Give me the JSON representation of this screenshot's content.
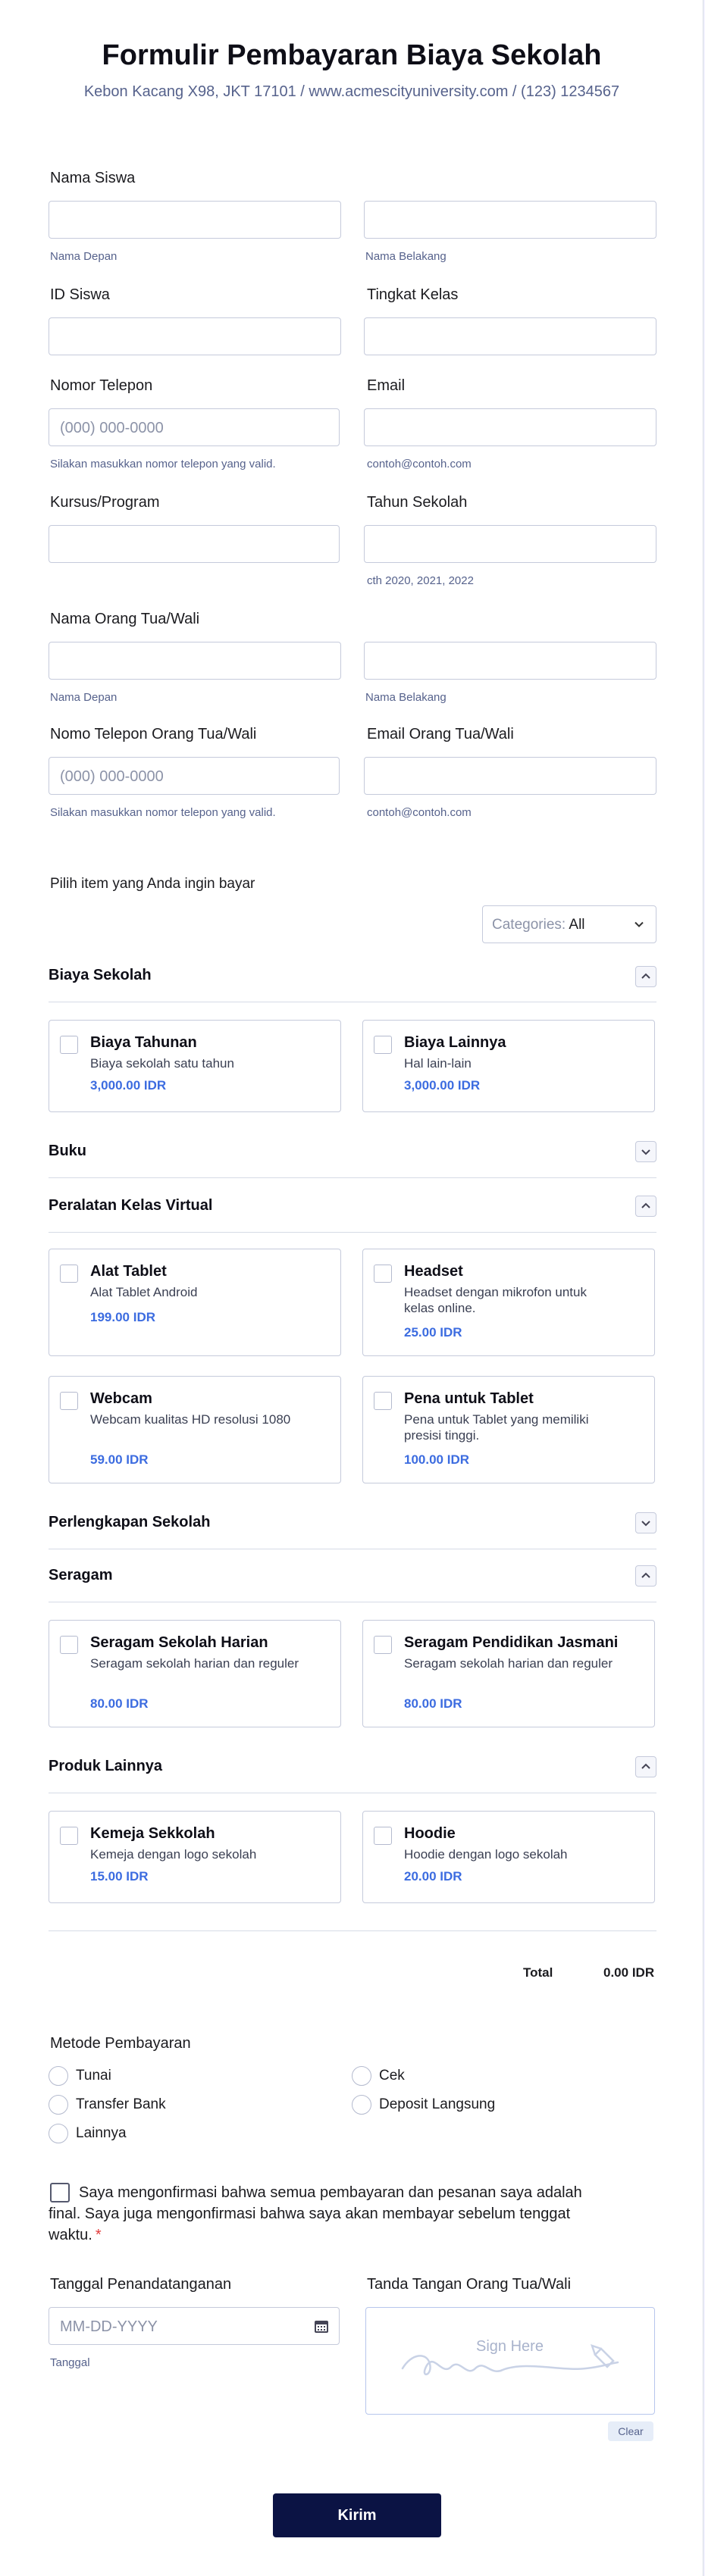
{
  "header": {
    "title": "Formulir Pembayaran Biaya Sekolah",
    "subtitle": "Kebon Kacang X98, JKT 17101 / www.acmescityuniversity.com / (123) 1234567"
  },
  "fields": {
    "student_name": {
      "label": "Nama Siswa",
      "first_sub": "Nama Depan",
      "last_sub": "Nama Belakang"
    },
    "student_id": {
      "label": "ID Siswa"
    },
    "grade": {
      "label": "Tingkat Kelas"
    },
    "phone": {
      "label": "Nomor Telepon",
      "placeholder": "(000) 000-0000",
      "sub": "Silakan masukkan nomor telepon yang valid."
    },
    "email": {
      "label": "Email",
      "sub": "contoh@contoh.com"
    },
    "course": {
      "label": "Kursus/Program"
    },
    "school_year": {
      "label": "Tahun Sekolah",
      "sub": "cth 2020, 2021, 2022"
    },
    "parent_name": {
      "label": "Nama Orang Tua/Wali",
      "first_sub": "Nama Depan",
      "last_sub": "Nama Belakang"
    },
    "parent_phone": {
      "label": "Nomo Telepon Orang Tua/Wali",
      "placeholder": "(000) 000-0000",
      "sub": "Silakan masukkan nomor telepon yang valid."
    },
    "parent_email": {
      "label": "Email Orang Tua/Wali",
      "sub": "contoh@contoh.com"
    }
  },
  "products_heading": "Pilih item yang Anda ingin bayar",
  "category_filter": {
    "label": "Categories:",
    "value": "All"
  },
  "sections": [
    {
      "title": "Biaya Sekolah",
      "expanded": true,
      "items": [
        {
          "name": "Biaya Tahunan",
          "desc": "Biaya sekolah satu tahun",
          "price": "3,000.00",
          "currency": "IDR"
        },
        {
          "name": "Biaya Lainnya",
          "desc": "Hal lain-lain",
          "price": "3,000.00",
          "currency": "IDR"
        }
      ]
    },
    {
      "title": "Buku",
      "expanded": false,
      "items": []
    },
    {
      "title": "Peralatan Kelas Virtual",
      "expanded": true,
      "items": [
        {
          "name": "Alat Tablet",
          "desc": "Alat Tablet Android",
          "price": "199.00",
          "currency": "IDR"
        },
        {
          "name": "Headset",
          "desc": "Headset dengan mikrofon untuk kelas online.",
          "price": "25.00",
          "currency": "IDR"
        },
        {
          "name": "Webcam",
          "desc": "Webcam kualitas HD resolusi 1080",
          "price": "59.00",
          "currency": "IDR"
        },
        {
          "name": "Pena untuk Tablet",
          "desc": "Pena untuk Tablet yang memiliki presisi tinggi.",
          "price": "100.00",
          "currency": "IDR"
        }
      ]
    },
    {
      "title": "Perlengkapan Sekolah",
      "expanded": false,
      "items": []
    },
    {
      "title": "Seragam",
      "expanded": true,
      "items": [
        {
          "name": "Seragam Sekolah Harian",
          "desc": "Seragam sekolah harian dan reguler",
          "price": "80.00",
          "currency": "IDR"
        },
        {
          "name": "Seragam Pendidikan Jasmani",
          "desc": "Seragam sekolah harian dan reguler",
          "price": "80.00",
          "currency": "IDR"
        }
      ]
    },
    {
      "title": "Produk Lainnya",
      "expanded": true,
      "items": [
        {
          "name": "Kemeja Sekkolah",
          "desc": "Kemeja dengan logo sekolah",
          "price": "15.00",
          "currency": "IDR"
        },
        {
          "name": "Hoodie",
          "desc": "Hoodie dengan logo sekolah",
          "price": "20.00",
          "currency": "IDR"
        }
      ]
    }
  ],
  "total": {
    "label": "Total",
    "value": "0.00",
    "currency": "IDR"
  },
  "payment": {
    "label": "Metode Pembayaran",
    "options": [
      "Tunai",
      "Cek",
      "Transfer Bank",
      "Deposit Langsung",
      "Lainnya"
    ]
  },
  "confirmation": {
    "text": "Saya mengonfirmasi bahwa semua pembayaran dan pesanan saya adalah final. Saya juga mengonfirmasi bahwa saya akan membayar sebelum tenggat waktu.",
    "required_mark": "*"
  },
  "signature_date": {
    "label": "Tanggal Penandatanganan",
    "placeholder": "MM-DD-YYYY",
    "sub": "Tanggal"
  },
  "signature": {
    "label": "Tanda Tangan Orang Tua/Wali",
    "hint": "Sign Here",
    "clear_label": "Clear"
  },
  "submit_label": "Kirim",
  "colors": {
    "accent": "#3c6ce0",
    "submit_bg": "#0b1344",
    "required": "#e23b3b"
  }
}
